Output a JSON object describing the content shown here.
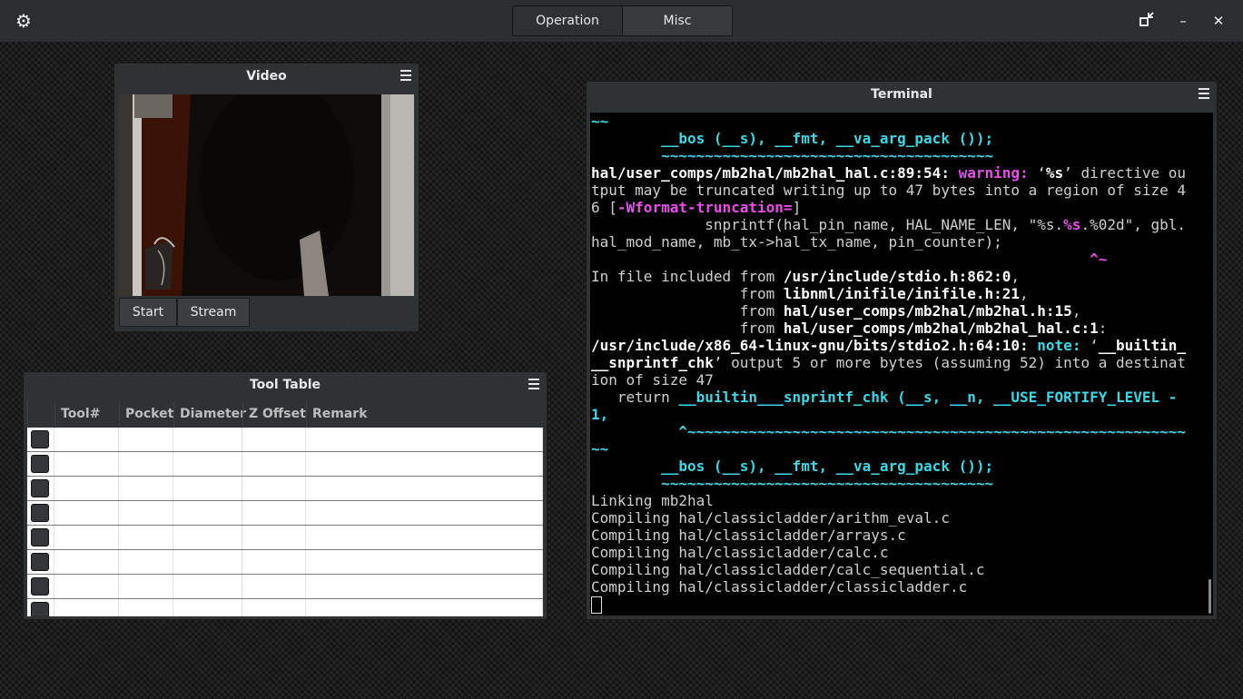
{
  "tabs": [
    {
      "label": "Operation",
      "active": true
    },
    {
      "label": "Misc",
      "active": false
    }
  ],
  "window_controls": {
    "restore_icon": "restore-icon",
    "minimize": "–",
    "close": "✕"
  },
  "video": {
    "title": "Video",
    "buttons": {
      "start": "Start",
      "stream": "Stream"
    }
  },
  "tool_table": {
    "title": "Tool Table",
    "columns": [
      "",
      "Tool#",
      "Pocket",
      "Diameter",
      "Z Offset",
      "Remark"
    ],
    "row_count": 8
  },
  "terminal": {
    "title": "Terminal",
    "lines": [
      [
        [
          "~~",
          "cy"
        ]
      ],
      [
        [
          "        ",
          ""
        ],
        [
          "__bos (__s), __fmt, __va_arg_pack ());",
          "cy"
        ]
      ],
      [
        [
          "        ~~~~~~~~~~~~~~~~~~~~~~~~~~~~~~~~~~~~~~",
          "cy"
        ]
      ],
      [
        [
          "hal/user_comps/mb2hal/mb2hal_hal.c:89:54: ",
          "b"
        ],
        [
          "warning: ",
          "mg"
        ],
        [
          "‘",
          ""
        ],
        [
          "%s",
          "b"
        ],
        [
          "’ directive ou",
          ""
        ]
      ],
      [
        [
          "tput may be truncated writing up to 47 bytes into a region of size 4",
          ""
        ]
      ],
      [
        [
          "6 [",
          ""
        ],
        [
          "-Wformat-truncation=",
          "mg"
        ],
        [
          "]",
          ""
        ]
      ],
      [
        [
          "             snprintf(hal_pin_name, HAL_NAME_LEN, \"%s.",
          ""
        ],
        [
          "%s",
          "mg"
        ],
        [
          ".%02d\", gbl.",
          ""
        ]
      ],
      [
        [
          "hal_mod_name, mb_tx->hal_tx_name, pin_counter);",
          ""
        ]
      ],
      [
        [
          "                                                         ",
          ""
        ],
        [
          "^~",
          "mg"
        ]
      ],
      [
        [
          "In file included from ",
          ""
        ],
        [
          "/usr/include/stdio.h:862:0",
          "b"
        ],
        [
          ",",
          ""
        ]
      ],
      [
        [
          "                 from ",
          ""
        ],
        [
          "libnml/inifile/inifile.h:21",
          "b"
        ],
        [
          ",",
          ""
        ]
      ],
      [
        [
          "                 from ",
          ""
        ],
        [
          "hal/user_comps/mb2hal/mb2hal.h:15",
          "b"
        ],
        [
          ",",
          ""
        ]
      ],
      [
        [
          "                 from ",
          ""
        ],
        [
          "hal/user_comps/mb2hal/mb2hal_hal.c:1",
          "b"
        ],
        [
          ":",
          ""
        ]
      ],
      [
        [
          "/usr/include/x86_64-linux-gnu/bits/stdio2.h:64:10: ",
          "b"
        ],
        [
          "note: ",
          "cy"
        ],
        [
          "‘",
          ""
        ],
        [
          "__builtin_",
          "b"
        ]
      ],
      [
        [
          "__snprintf_chk",
          "b"
        ],
        [
          "’ output 5 or more bytes (assuming 52) into a destinat",
          ""
        ]
      ],
      [
        [
          "ion of size 47",
          ""
        ]
      ],
      [
        [
          "   return ",
          ""
        ],
        [
          "__builtin___snprintf_chk (__s, __n, __USE_FORTIFY_LEVEL -",
          "cy"
        ]
      ],
      [
        [
          "1,",
          "cy"
        ]
      ],
      [
        [
          "          ^~~~~~~~~~~~~~~~~~~~~~~~~~~~~~~~~~~~~~~~~~~~~~~~~~~~~~~~~~",
          "cy"
        ]
      ],
      [
        [
          "~~",
          "cy"
        ]
      ],
      [
        [
          "        ",
          ""
        ],
        [
          "__bos (__s), __fmt, __va_arg_pack ());",
          "cy"
        ]
      ],
      [
        [
          "        ~~~~~~~~~~~~~~~~~~~~~~~~~~~~~~~~~~~~~~",
          "cy"
        ]
      ],
      [
        [
          "Linking mb2hal",
          ""
        ]
      ],
      [
        [
          "Compiling hal/classicladder/arithm_eval.c",
          ""
        ]
      ],
      [
        [
          "Compiling hal/classicladder/arrays.c",
          ""
        ]
      ],
      [
        [
          "Compiling hal/classicladder/calc.c",
          ""
        ]
      ],
      [
        [
          "Compiling hal/classicladder/calc_sequential.c",
          ""
        ]
      ],
      [
        [
          "Compiling hal/classicladder/classicladder.c",
          ""
        ]
      ]
    ]
  }
}
